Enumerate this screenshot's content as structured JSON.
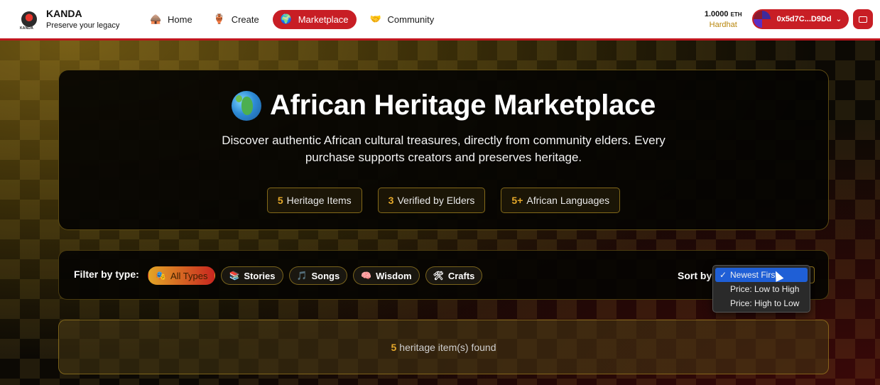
{
  "brand": {
    "name": "KANDA",
    "tagline": "Preserve your legacy",
    "logo_text": "KANDA"
  },
  "nav": {
    "items": [
      {
        "label": "Home",
        "icon": "🛖",
        "icon_name": "hut-icon",
        "active": false
      },
      {
        "label": "Create",
        "icon": "🏺",
        "icon_name": "amphora-icon",
        "active": false
      },
      {
        "label": "Marketplace",
        "icon": "🌍",
        "icon_name": "globe-icon",
        "active": true
      },
      {
        "label": "Community",
        "icon": "🤝",
        "icon_name": "handshake-icon",
        "active": false
      }
    ]
  },
  "wallet": {
    "balance": "1.0000",
    "unit": "ETH",
    "network": "Hardhat",
    "address": "0x5d7C...D9Dd"
  },
  "hero": {
    "title": "African Heritage Marketplace",
    "subtitle": "Discover authentic African cultural treasures, directly from community elders. Every purchase supports creators and preserves heritage.",
    "stats": [
      {
        "value": "5",
        "label": "Heritage Items"
      },
      {
        "value": "3",
        "label": "Verified by Elders"
      },
      {
        "value": "5+",
        "label": "African Languages"
      }
    ]
  },
  "filters": {
    "label": "Filter by type:",
    "chips": [
      {
        "label": "All Types",
        "icon": "🎭",
        "active": true
      },
      {
        "label": "Stories",
        "icon": "📚",
        "active": false
      },
      {
        "label": "Songs",
        "icon": "🎵",
        "active": false
      },
      {
        "label": "Wisdom",
        "icon": "🧠",
        "active": false
      },
      {
        "label": "Crafts",
        "icon": "🛠",
        "active": false
      }
    ],
    "sort_label": "Sort by",
    "sort_options": [
      {
        "label": "Newest First",
        "selected": true
      },
      {
        "label": "Price: Low to High",
        "selected": false
      },
      {
        "label": "Price: High to Low",
        "selected": false
      }
    ]
  },
  "results": {
    "count": "5",
    "text": "heritage item(s) found"
  },
  "colors": {
    "accent_red": "#c81e25",
    "accent_gold": "#e5a82a",
    "border_gold": "#c9a227"
  }
}
